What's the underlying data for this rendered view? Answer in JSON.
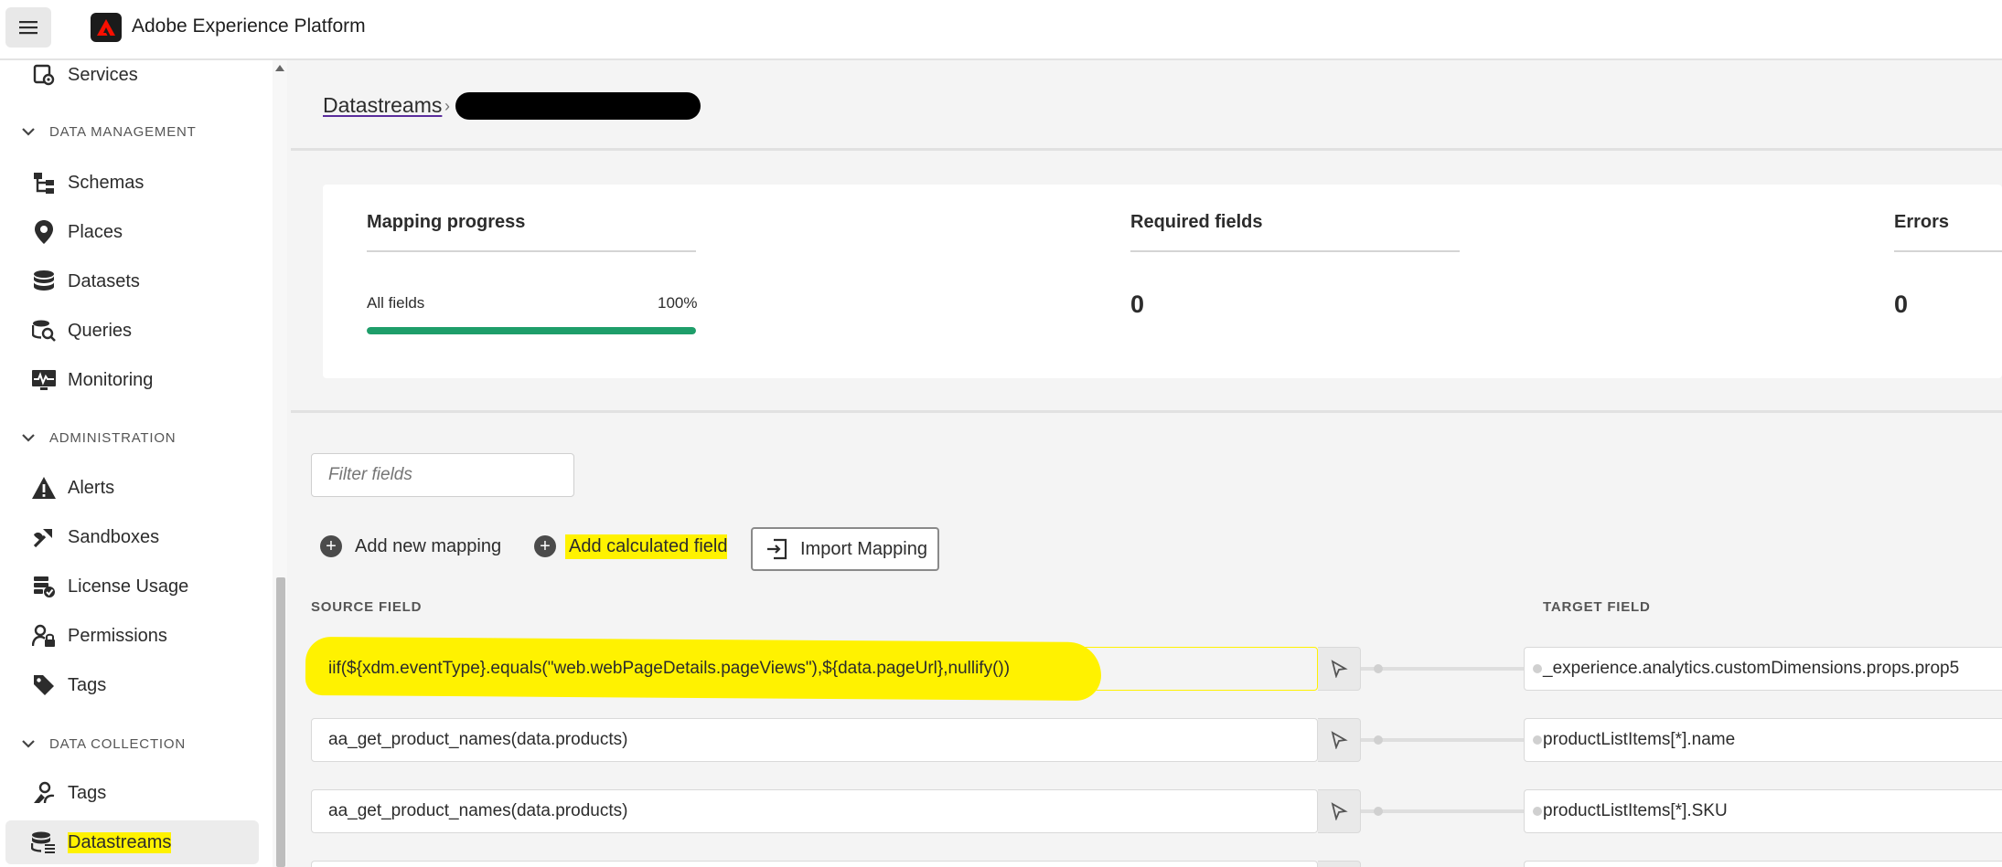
{
  "app": {
    "title": "Adobe Experience Platform"
  },
  "sidebar": {
    "items_top": [
      {
        "label": "Services",
        "icon": "services-gear-icon"
      }
    ],
    "sections": [
      {
        "label": "DATA MANAGEMENT",
        "items": [
          {
            "label": "Schemas",
            "icon": "schema-icon"
          },
          {
            "label": "Places",
            "icon": "map-pin-icon"
          },
          {
            "label": "Datasets",
            "icon": "database-icon"
          },
          {
            "label": "Queries",
            "icon": "query-icon"
          },
          {
            "label": "Monitoring",
            "icon": "monitoring-icon"
          }
        ]
      },
      {
        "label": "ADMINISTRATION",
        "items": [
          {
            "label": "Alerts",
            "icon": "alert-icon"
          },
          {
            "label": "Sandboxes",
            "icon": "sandbox-icon"
          },
          {
            "label": "License Usage",
            "icon": "license-icon"
          },
          {
            "label": "Permissions",
            "icon": "permissions-icon"
          },
          {
            "label": "Tags",
            "icon": "tag-icon"
          }
        ]
      },
      {
        "label": "DATA COLLECTION",
        "items": [
          {
            "label": "Tags",
            "icon": "tags-icon"
          },
          {
            "label": "Datastreams",
            "icon": "datastreams-icon",
            "active": true
          }
        ]
      }
    ]
  },
  "breadcrumb": {
    "link": "Datastreams",
    "separator": "›"
  },
  "summary": {
    "mapping_progress": {
      "title": "Mapping progress",
      "label": "All fields",
      "percent_text": "100%",
      "percent": 100
    },
    "required_fields": {
      "title": "Required fields",
      "value": "0"
    },
    "errors": {
      "title": "Errors",
      "value": "0"
    }
  },
  "filter": {
    "placeholder": "Filter fields"
  },
  "actions": {
    "add_mapping": "Add new mapping",
    "add_calculated": "Add calculated field",
    "import_mapping": "Import Mapping"
  },
  "columns": {
    "source": "SOURCE FIELD",
    "target": "TARGET FIELD"
  },
  "mappings": [
    {
      "source": "iif(${xdm.eventType}.equals(\"web.webPageDetails.pageViews\"),${data.pageUrl},nullify())",
      "target": "_experience.analytics.customDimensions.props.prop5"
    },
    {
      "source": "aa_get_product_names(data.products)",
      "target": "productListItems[*].name"
    },
    {
      "source": "aa_get_product_names(data.products)",
      "target": "productListItems[*].SKU"
    }
  ],
  "colors": {
    "progress": "#1e9e6a",
    "highlight": "#fff200",
    "link_underline": "#5a2d9c"
  }
}
